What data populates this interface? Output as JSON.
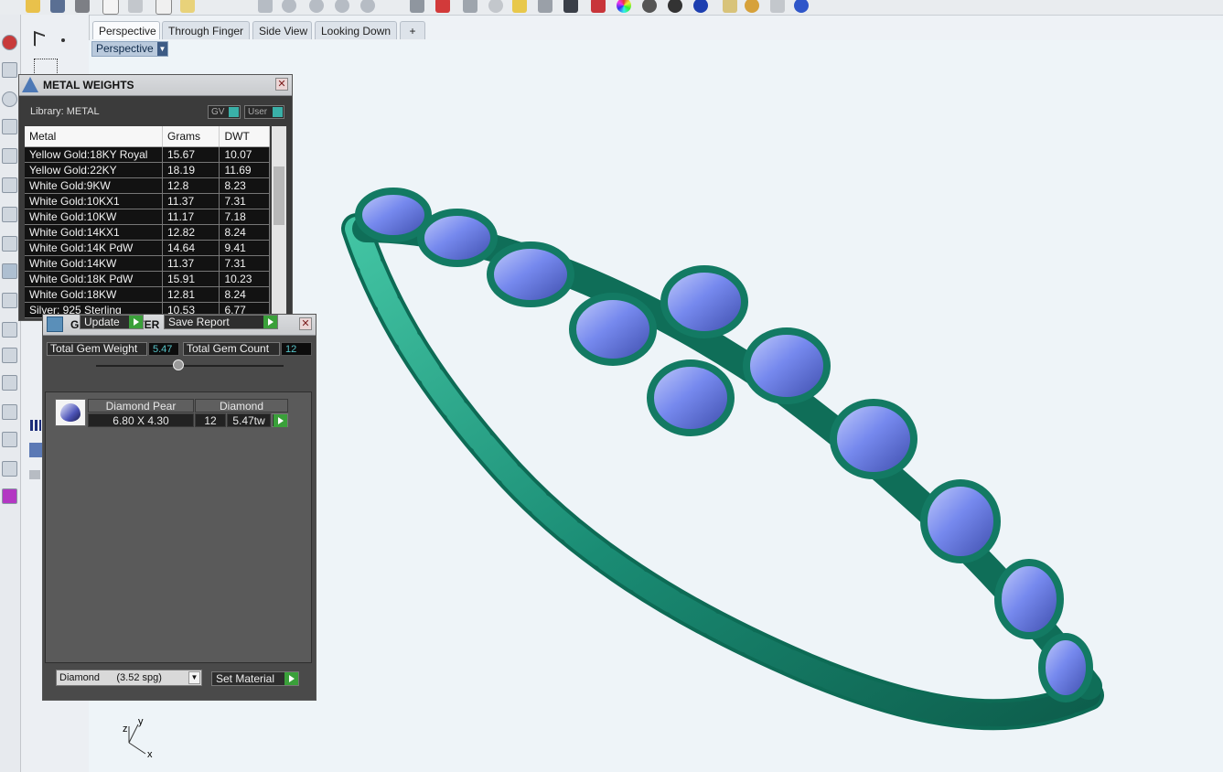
{
  "toolbar": {
    "icons": [
      "open-icon",
      "save-icon",
      "print-icon",
      "new-icon",
      "cut-icon",
      "copy-icon",
      "paste-icon",
      "pan-icon",
      "zoom-icon",
      "zoom-window-icon",
      "zoom-extents-icon",
      "zoom-selected-icon",
      "four-views-icon",
      "car-icon",
      "settings-icon",
      "rotate-icon",
      "select-icon",
      "light-icon",
      "layer-icon",
      "material-icon",
      "color-wheel-icon",
      "render-sphere-icon",
      "render-sphere-dark-icon",
      "render-sphere-blue-icon",
      "pen-icon",
      "gear-icon",
      "crop-icon",
      "help-icon"
    ]
  },
  "tabs": [
    {
      "label": "Perspective",
      "active": true
    },
    {
      "label": "Through Finger",
      "active": false
    },
    {
      "label": "Side View",
      "active": false
    },
    {
      "label": "Looking Down",
      "active": false
    },
    {
      "label": "+",
      "active": false
    }
  ],
  "viewport": {
    "label": "Perspective"
  },
  "metal_panel": {
    "title": "METAL WEIGHTS",
    "library_label": "Library: METAL",
    "toggle_gv": "GV",
    "toggle_user": "User",
    "columns": [
      "Metal",
      "Grams",
      "DWT"
    ],
    "rows": [
      [
        "Yellow Gold:18KY Royal",
        "15.67",
        "10.07"
      ],
      [
        "Yellow Gold:22KY",
        "18.19",
        "11.69"
      ],
      [
        "White Gold:9KW",
        "12.8",
        "8.23"
      ],
      [
        "White Gold:10KX1",
        "11.37",
        "7.31"
      ],
      [
        "White Gold:10KW",
        "11.17",
        "7.18"
      ],
      [
        "White Gold:14KX1",
        "12.82",
        "8.24"
      ],
      [
        "White Gold:14K PdW",
        "14.64",
        "9.41"
      ],
      [
        "White Gold:14KW",
        "11.37",
        "7.31"
      ],
      [
        "White Gold:18K PdW",
        "15.91",
        "10.23"
      ],
      [
        "White Gold:18KW",
        "12.81",
        "8.24"
      ],
      [
        "Silver: 925 Sterling",
        "10.53",
        "6.77"
      ]
    ]
  },
  "gem_panel": {
    "title": "GEM REPORTER",
    "total_weight_label": "Total Gem Weight",
    "total_weight_value": "5.47",
    "total_count_label": "Total Gem Count",
    "total_count_value": "12",
    "update_label": "Update",
    "save_label": "Save Report",
    "gem_name": "Diamond Pear",
    "gem_material": "Diamond",
    "gem_size": "6.80 X 4.30",
    "gem_count": "12",
    "gem_weight": "5.47tw",
    "material_select": "Diamond      (3.52 spg)",
    "set_material_label": "Set Material"
  },
  "axes": {
    "x": "x",
    "y": "y",
    "z": "z"
  },
  "colors": {
    "metal": "#1f8f78",
    "gem": "#6f80e6",
    "viewport_bg": "#eef4f8"
  }
}
